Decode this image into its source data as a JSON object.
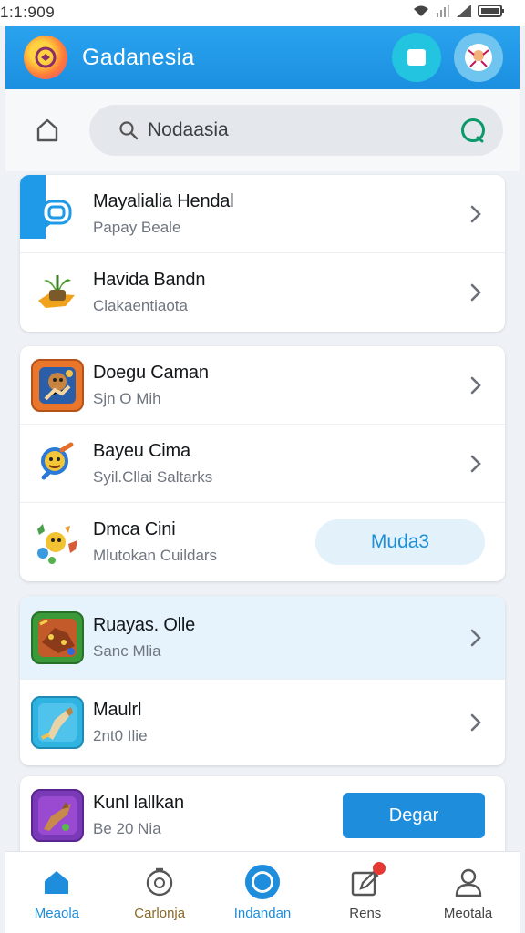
{
  "status_bar": {
    "time": "1:1:909"
  },
  "app_bar": {
    "title": "Gadanesia"
  },
  "search": {
    "placeholder": "Nodaasia"
  },
  "groups": [
    {
      "rows": [
        {
          "title": "Mayalialia Hendal",
          "subtitle": "Papay Beale",
          "action": "chevron",
          "icon": "chat-bubble-icon"
        },
        {
          "title": "Havida Bandn",
          "subtitle": "Clakaentiaota",
          "action": "chevron",
          "icon": "plant-pot-icon"
        }
      ]
    },
    {
      "rows": [
        {
          "title": "Doegu Caman",
          "subtitle": "Sjn O Mih",
          "action": "chevron",
          "icon": "monkey-game-icon"
        },
        {
          "title": "Bayeu Cima",
          "subtitle": "Syil.Cllai Saltarks",
          "action": "chevron",
          "icon": "magnifier-character-icon"
        },
        {
          "title": "Dmca Cini",
          "subtitle": "Mlutokan Cuildars",
          "action": "button",
          "action_label": "Muda3",
          "icon": "fruit-characters-icon"
        }
      ]
    },
    {
      "rows": [
        {
          "title": "Ruayas. Olle",
          "subtitle": "Sanc Mlia",
          "action": "chevron",
          "icon": "treasure-game-icon",
          "highlighted": true
        },
        {
          "title": "Maulrl",
          "subtitle": "2nt0 Ilie",
          "action": "chevron",
          "icon": "adventure-game-icon"
        }
      ]
    },
    {
      "rows": [
        {
          "title": "Kunl lallkan",
          "subtitle": "Be 20 Nia",
          "action": "solid-button",
          "action_label": "Degar",
          "icon": "dragon-game-icon"
        }
      ]
    }
  ],
  "bottom_nav": [
    {
      "label": "Meaola",
      "icon": "home-icon",
      "active": true,
      "color": "#1e8ddc"
    },
    {
      "label": "Carlonja",
      "icon": "compass-icon",
      "color": "#8a6a2a"
    },
    {
      "label": "Indandan",
      "icon": "circle-icon",
      "color": "#1e8ddc"
    },
    {
      "label": "Rens",
      "icon": "edit-icon",
      "color": "#444444",
      "badge": true
    },
    {
      "label": "Meotala",
      "icon": "person-icon",
      "color": "#444444"
    }
  ],
  "colors": {
    "accent": "#1e8ddc",
    "app_bar": "#1b8fe0",
    "highlight": "#e6f3fd"
  }
}
